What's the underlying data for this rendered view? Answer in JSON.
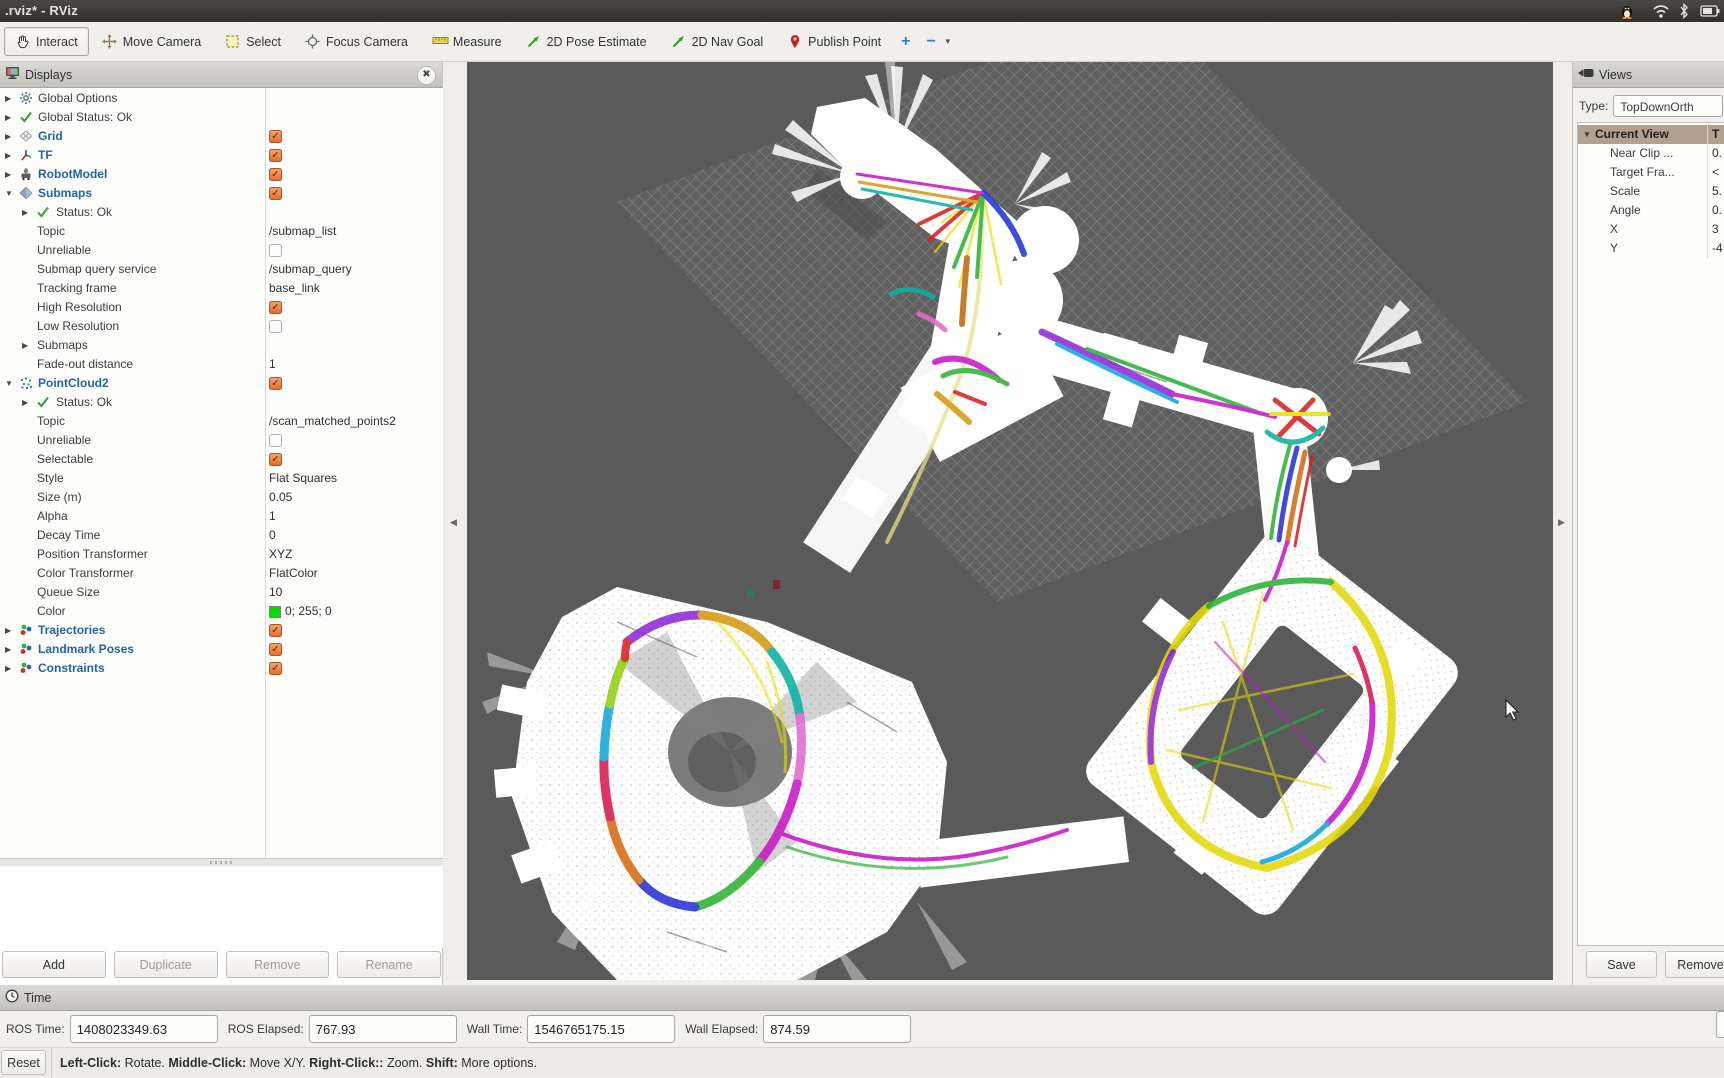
{
  "window": {
    "title": ".rviz* - RViz"
  },
  "tray_icons": [
    "linux-penguin-icon",
    "wifi-icon",
    "bluetooth-icon",
    "battery-icon"
  ],
  "toolbar": {
    "tools": [
      {
        "label": "Interact",
        "icon": "hand",
        "active": true
      },
      {
        "label": "Move Camera",
        "icon": "move-camera",
        "active": false
      },
      {
        "label": "Select",
        "icon": "select-box",
        "active": false
      },
      {
        "label": "Focus Camera",
        "icon": "focus-crosshair",
        "active": false
      },
      {
        "label": "Measure",
        "icon": "ruler",
        "active": false
      },
      {
        "label": "2D Pose Estimate",
        "icon": "green-arrow",
        "active": false
      },
      {
        "label": "2D Nav Goal",
        "icon": "green-arrow",
        "active": false
      },
      {
        "label": "Publish Point",
        "icon": "red-pin",
        "active": false
      }
    ],
    "add_tool_label": "+",
    "remove_tool_label": "−"
  },
  "displays_panel": {
    "title": "Displays",
    "rows": [
      {
        "kind": "display",
        "arrow": "right",
        "icon": "gear",
        "label": "Global Options"
      },
      {
        "kind": "display",
        "arrow": "right",
        "icon": "check-ok",
        "label": "Global Status: Ok"
      },
      {
        "kind": "display",
        "arrow": "right",
        "icon": "grid-cell",
        "label": "Grid",
        "bold": true,
        "check": "on"
      },
      {
        "kind": "display",
        "arrow": "right",
        "icon": "tf-axes",
        "label": "TF",
        "bold": true,
        "check": "on"
      },
      {
        "kind": "display",
        "arrow": "right",
        "icon": "robot",
        "label": "RobotModel",
        "bold": true,
        "check": "on"
      },
      {
        "kind": "display",
        "arrow": "down",
        "icon": "submap-diamond",
        "label": "Submaps",
        "bold": true,
        "check": "on"
      },
      {
        "kind": "status",
        "arrow": "right",
        "icon": "check-ok",
        "label": "Status: Ok"
      },
      {
        "kind": "prop",
        "label": "Topic",
        "value": "/submap_list"
      },
      {
        "kind": "prop",
        "label": "Unreliable",
        "check": "off"
      },
      {
        "kind": "prop",
        "label": "Submap query service",
        "value": "/submap_query"
      },
      {
        "kind": "prop",
        "label": "Tracking frame",
        "value": "base_link"
      },
      {
        "kind": "prop",
        "label": "High Resolution",
        "check": "on"
      },
      {
        "kind": "prop",
        "label": "Low Resolution",
        "check": "off"
      },
      {
        "kind": "group",
        "arrow": "right",
        "label": "Submaps"
      },
      {
        "kind": "prop",
        "label": "Fade-out distance",
        "value": "1"
      },
      {
        "kind": "display",
        "arrow": "down",
        "icon": "pointcloud-dots",
        "label": "PointCloud2",
        "bold": true,
        "check": "on"
      },
      {
        "kind": "status",
        "arrow": "right",
        "icon": "check-ok",
        "label": "Status: Ok"
      },
      {
        "kind": "prop",
        "label": "Topic",
        "value": "/scan_matched_points2"
      },
      {
        "kind": "prop",
        "label": "Unreliable",
        "check": "off"
      },
      {
        "kind": "prop",
        "label": "Selectable",
        "check": "on"
      },
      {
        "kind": "prop",
        "label": "Style",
        "value": "Flat Squares"
      },
      {
        "kind": "prop",
        "label": "Size (m)",
        "value": "0.05"
      },
      {
        "kind": "prop",
        "label": "Alpha",
        "value": "1"
      },
      {
        "kind": "prop",
        "label": "Decay Time",
        "value": "0"
      },
      {
        "kind": "prop",
        "label": "Position Transformer",
        "value": "XYZ"
      },
      {
        "kind": "prop",
        "label": "Color Transformer",
        "value": "FlatColor"
      },
      {
        "kind": "prop",
        "label": "Queue Size",
        "value": "10"
      },
      {
        "kind": "prop",
        "label": "Color",
        "value": "0; 255; 0",
        "swatch": "#00dd00"
      },
      {
        "kind": "display",
        "arrow": "right",
        "icon": "marker-dots",
        "label": "Trajectories",
        "bold": true,
        "check": "on"
      },
      {
        "kind": "display",
        "arrow": "right",
        "icon": "marker-dots",
        "label": "Landmark Poses",
        "bold": true,
        "check": "on"
      },
      {
        "kind": "display",
        "arrow": "right",
        "icon": "marker-dots",
        "label": "Constraints",
        "bold": true,
        "check": "on"
      }
    ],
    "buttons": [
      {
        "label": "Add",
        "enabled": true
      },
      {
        "label": "Duplicate",
        "enabled": false
      },
      {
        "label": "Remove",
        "enabled": false
      },
      {
        "label": "Rename",
        "enabled": false
      }
    ]
  },
  "views_panel": {
    "title": "Views",
    "type_label": "Type:",
    "type_value": "TopDownOrth",
    "rows": [
      {
        "kind": "header",
        "arrow": "down",
        "label": "Current View",
        "value": "T",
        "selected": true
      },
      {
        "kind": "prop",
        "label": "Near Clip ...",
        "value": "0."
      },
      {
        "kind": "prop",
        "label": "Target Fra...",
        "value": "<"
      },
      {
        "kind": "prop",
        "label": "Scale",
        "value": "5."
      },
      {
        "kind": "prop",
        "label": "Angle",
        "value": "0."
      },
      {
        "kind": "prop",
        "label": "X",
        "value": "3"
      },
      {
        "kind": "prop",
        "label": "Y",
        "value": "-4"
      }
    ],
    "buttons": [
      {
        "label": "Save",
        "enabled": true
      },
      {
        "label": "Remove",
        "enabled": true
      }
    ]
  },
  "time_panel": {
    "title": "Time",
    "fields": [
      {
        "label": "ROS Time:",
        "value": "1408023349.63"
      },
      {
        "label": "ROS Elapsed:",
        "value": "767.93"
      },
      {
        "label": "Wall Time:",
        "value": "1546765175.15"
      },
      {
        "label": "Wall Elapsed:",
        "value": "874.59"
      }
    ]
  },
  "status_bar": {
    "reset_label": "Reset",
    "help": [
      {
        "key": "Left-Click:",
        "text": " Rotate. "
      },
      {
        "key": "Middle-Click:",
        "text": " Move X/Y. "
      },
      {
        "key": "Right-Click::",
        "text": " Zoom. "
      },
      {
        "key": "Shift:",
        "text": " More options."
      }
    ]
  },
  "colors": {
    "display_name_blue": "#2264a7",
    "checkbox_checked_orange": "#e8702c",
    "selection_tan": "#b2a18d",
    "status_ok_green": "#3f9e36",
    "pointcloud_color_value": "#00dd00",
    "viewport_background": "#5a5a5a"
  }
}
